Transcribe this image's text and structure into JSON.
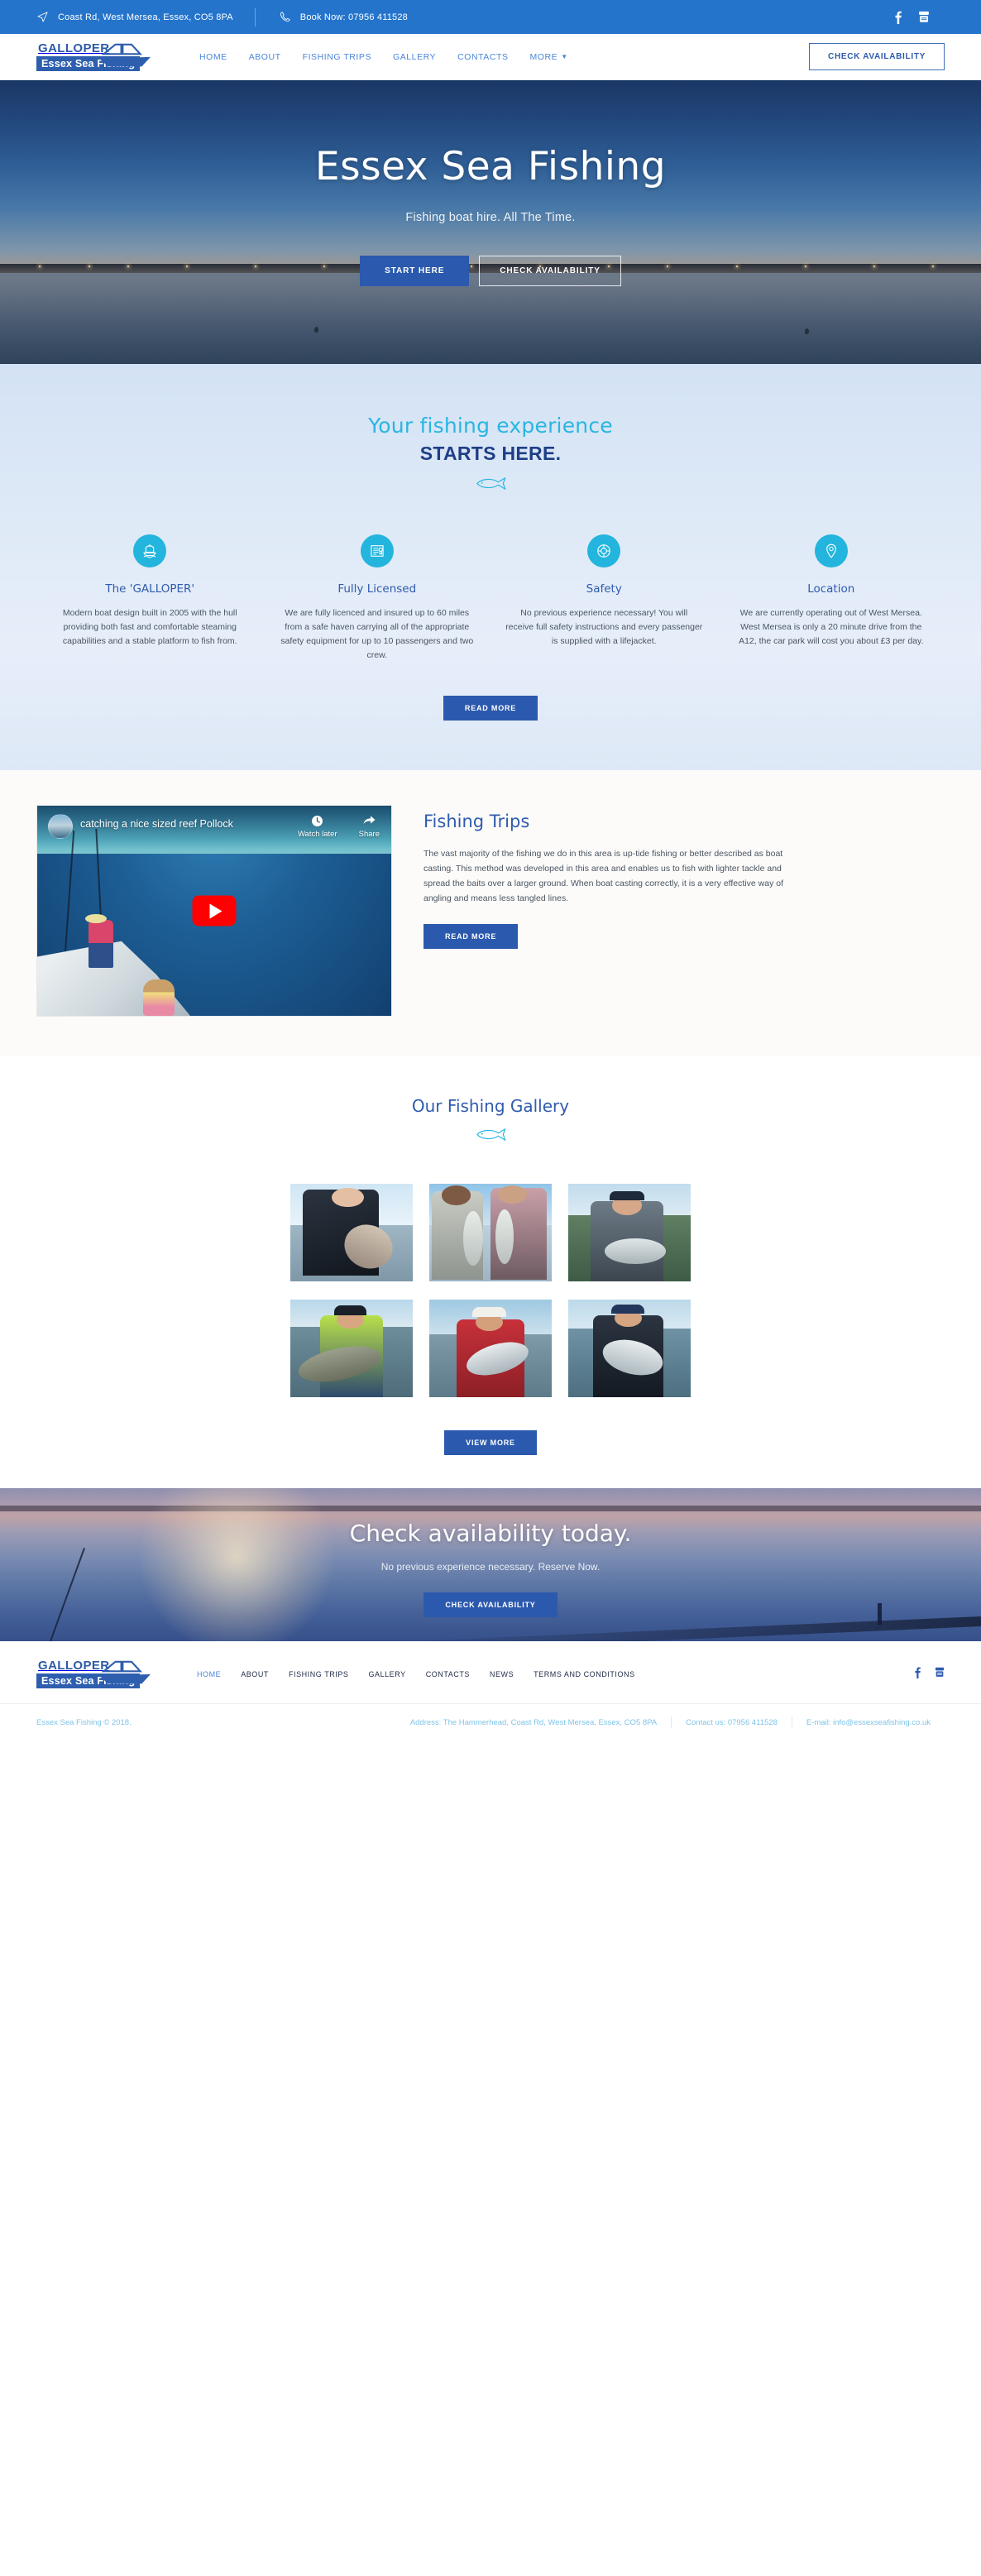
{
  "topbar": {
    "address": "Coast Rd, West Mersea, Essex, CO5 8PA",
    "phone": "Book Now: 07956 411528",
    "social": [
      {
        "name": "facebook-icon",
        "label": "f"
      },
      {
        "name": "youtube-icon",
        "label": "YouTube"
      }
    ]
  },
  "header": {
    "logo_top": "GALLOPER",
    "logo_band": "Essex Sea Fishing",
    "nav": [
      {
        "label": "HOME",
        "active": true
      },
      {
        "label": "ABOUT",
        "active": false
      },
      {
        "label": "FISHING TRIPS",
        "active": false
      },
      {
        "label": "GALLERY",
        "active": false
      },
      {
        "label": "CONTACTS",
        "active": false
      },
      {
        "label": "MORE",
        "active": false,
        "chevron": true
      }
    ],
    "cta_label": "CHECK AVAILABILITY"
  },
  "hero": {
    "title": "Essex Sea Fishing",
    "subtitle": "Fishing boat hire. All The Time.",
    "primary_button": "START HERE",
    "secondary_button": "CHECK AVAILABILITY"
  },
  "features": {
    "script_heading": "Your fishing experience",
    "bold_heading": "STARTS HERE.",
    "divider_icon": "fish-icon",
    "items": [
      {
        "icon": "ship-icon",
        "title": "The 'GALLOPER'",
        "text": "Modern boat design built in 2005 with the hull providing both fast and comfortable steaming capabilities and a stable platform to fish from."
      },
      {
        "icon": "certificate-icon",
        "title": "Fully Licensed",
        "text": "We are fully licenced and insured up to 60 miles from a safe haven carrying all of the appropriate safety equipment for up to 10 passengers and two crew."
      },
      {
        "icon": "lifebuoy-icon",
        "title": "Safety",
        "text": "No previous experience necessary! You will receive full safety instructions and every passenger is supplied with a lifejacket."
      },
      {
        "icon": "map-pin-icon",
        "title": "Location",
        "text": "We are currently operating out of West Mersea. West Mersea is only a 20 minute drive from the A12, the car park will cost you about £3 per day."
      }
    ],
    "read_more": "READ MORE"
  },
  "trips": {
    "video": {
      "title": "catching a nice sized reef Pollock",
      "watch_later": "Watch later",
      "share": "Share",
      "play_icon": "play-button-icon"
    },
    "heading": "Fishing Trips",
    "text": "The vast majority of the fishing we do in this area is up-tide fishing or better described as boat casting. This method was developed in this area and enables us to fish with lighter tackle and spread the baits over a larger ground. When boat casting correctly, it is a very effective way of angling and means less tangled lines.",
    "read_more": "READ MORE"
  },
  "gallery": {
    "heading": "Our Fishing Gallery",
    "divider_icon": "fish-icon",
    "photos": [
      {
        "alt": "angler in dark jacket holding a codling"
      },
      {
        "alt": "two women holding bass on deck"
      },
      {
        "alt": "man in navy cap holding a bass"
      },
      {
        "alt": "angler in hi-vis jacket with large cod"
      },
      {
        "alt": "angler in red shirt and white cap with bass"
      },
      {
        "alt": "angler in blue cap holding a large bass"
      }
    ],
    "view_more": "VIEW MORE"
  },
  "cta": {
    "title": "Check availability today.",
    "subtitle": "No previous experience necessary. Reserve Now.",
    "button": "CHECK AVAILABILITY"
  },
  "footer": {
    "logo_top": "GALLOPER",
    "logo_band": "Essex Sea Fishing",
    "nav": [
      {
        "label": "HOME",
        "active": true
      },
      {
        "label": "ABOUT",
        "active": false
      },
      {
        "label": "FISHING TRIPS",
        "active": false
      },
      {
        "label": "GALLERY",
        "active": false
      },
      {
        "label": "CONTACTS",
        "active": false
      },
      {
        "label": "NEWS",
        "active": false
      },
      {
        "label": "TERMS AND CONDITIONS",
        "active": false
      }
    ],
    "social": [
      {
        "name": "facebook-icon"
      },
      {
        "name": "youtube-icon"
      }
    ],
    "copyright": "Essex Sea Fishing © 2018.",
    "address": "Address: The Hammerhead, Coast Rd, West Mersea, Essex, CO5 8PA",
    "contact": "Contact us: 07956 411528",
    "email": "E-mail: info@essexseafishing.co.uk"
  },
  "colors": {
    "topbar_blue": "#2474cc",
    "nav_blue": "#4a86d8",
    "brand_navy": "#2d5aa8",
    "button_blue": "#2b59ad",
    "accent_cyan": "#23b5dd",
    "footer_text": "#7fc4e8"
  }
}
